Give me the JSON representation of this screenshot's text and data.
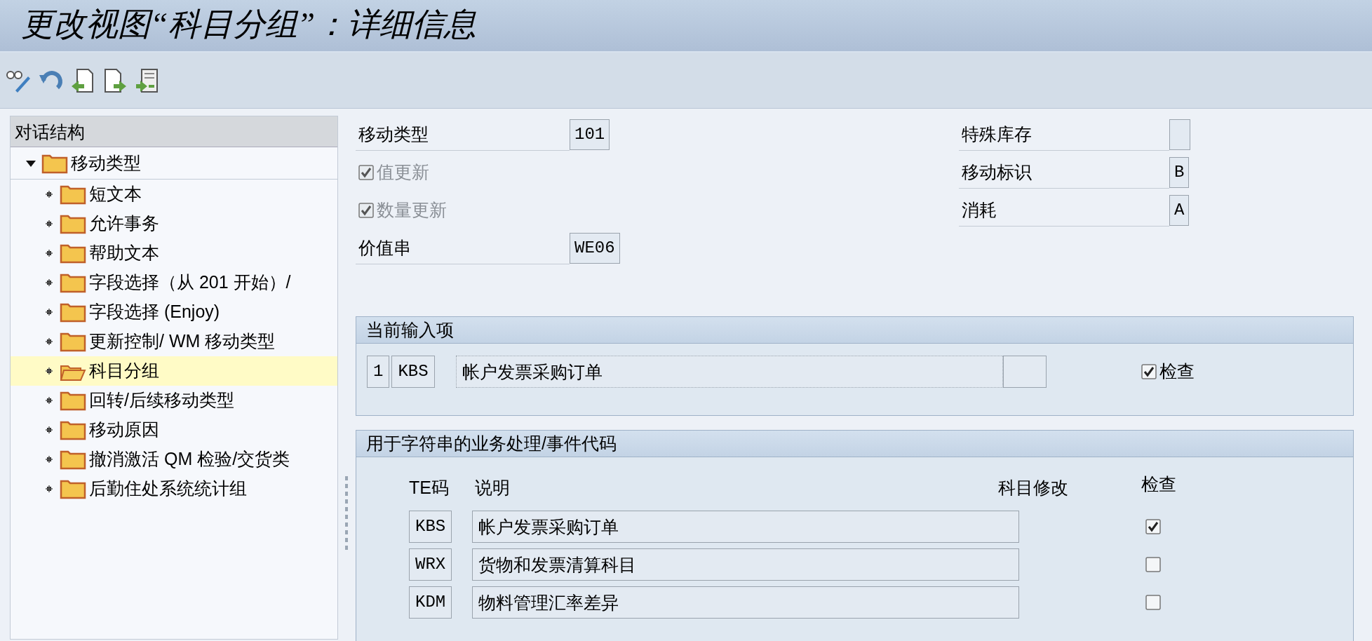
{
  "window": {
    "title": "更改视图“科目分组”：详细信息"
  },
  "tree": {
    "header": "对话结构",
    "items": [
      {
        "label": "移动类型",
        "expanded": true,
        "selected": false,
        "children": [
          {
            "label": "短文本",
            "expanded": false,
            "selected": false
          },
          {
            "label": "允许事务",
            "expanded": false,
            "selected": false
          },
          {
            "label": "帮助文本",
            "expanded": false,
            "selected": false
          },
          {
            "label": "字段选择（从 201 开始）/",
            "expanded": false,
            "selected": false
          },
          {
            "label": "字段选择 (Enjoy)",
            "expanded": false,
            "selected": false
          },
          {
            "label": "更新控制/ WM 移动类型",
            "expanded": false,
            "selected": false
          },
          {
            "label": "科目分组",
            "expanded": false,
            "selected": true
          },
          {
            "label": "回转/后续移动类型",
            "expanded": false,
            "selected": false
          },
          {
            "label": "移动原因",
            "expanded": false,
            "selected": false
          },
          {
            "label": "撤消激活 QM 检验/交货类",
            "expanded": false,
            "selected": false
          },
          {
            "label": "后勤住处系统统计组",
            "expanded": false,
            "selected": false
          }
        ]
      }
    ]
  },
  "form": {
    "left": [
      {
        "kind": "field",
        "label": "移动类型",
        "value": "101"
      },
      {
        "kind": "checkbox",
        "label": "值更新",
        "checked": true,
        "disabled": true
      },
      {
        "kind": "checkbox",
        "label": "数量更新",
        "checked": true,
        "disabled": true
      },
      {
        "kind": "field",
        "label": "价值串",
        "value": "WE06"
      }
    ],
    "right": [
      {
        "kind": "field",
        "label": "特殊库存"
      },
      {
        "kind": "field",
        "label": "移动标识",
        "value": "B"
      },
      {
        "kind": "field",
        "label": "消耗",
        "value": "A"
      }
    ]
  },
  "current_entry": {
    "title": "当前输入项",
    "number": "1",
    "code": "KBS",
    "description": "帐户发票采购订单",
    "check_label": "检查",
    "checked": true
  },
  "transactions": {
    "title": "用于字符串的业务处理/事件代码",
    "columns": [
      "TE码",
      "说明",
      "科目修改",
      "检查"
    ],
    "rows": [
      {
        "code": "KBS",
        "description": "帐户发票采购订单",
        "checked": true
      },
      {
        "code": "WRX",
        "description": "货物和发票清算科目",
        "checked": false
      },
      {
        "code": "KDM",
        "description": "物料管理汇率差异",
        "checked": false
      }
    ]
  }
}
